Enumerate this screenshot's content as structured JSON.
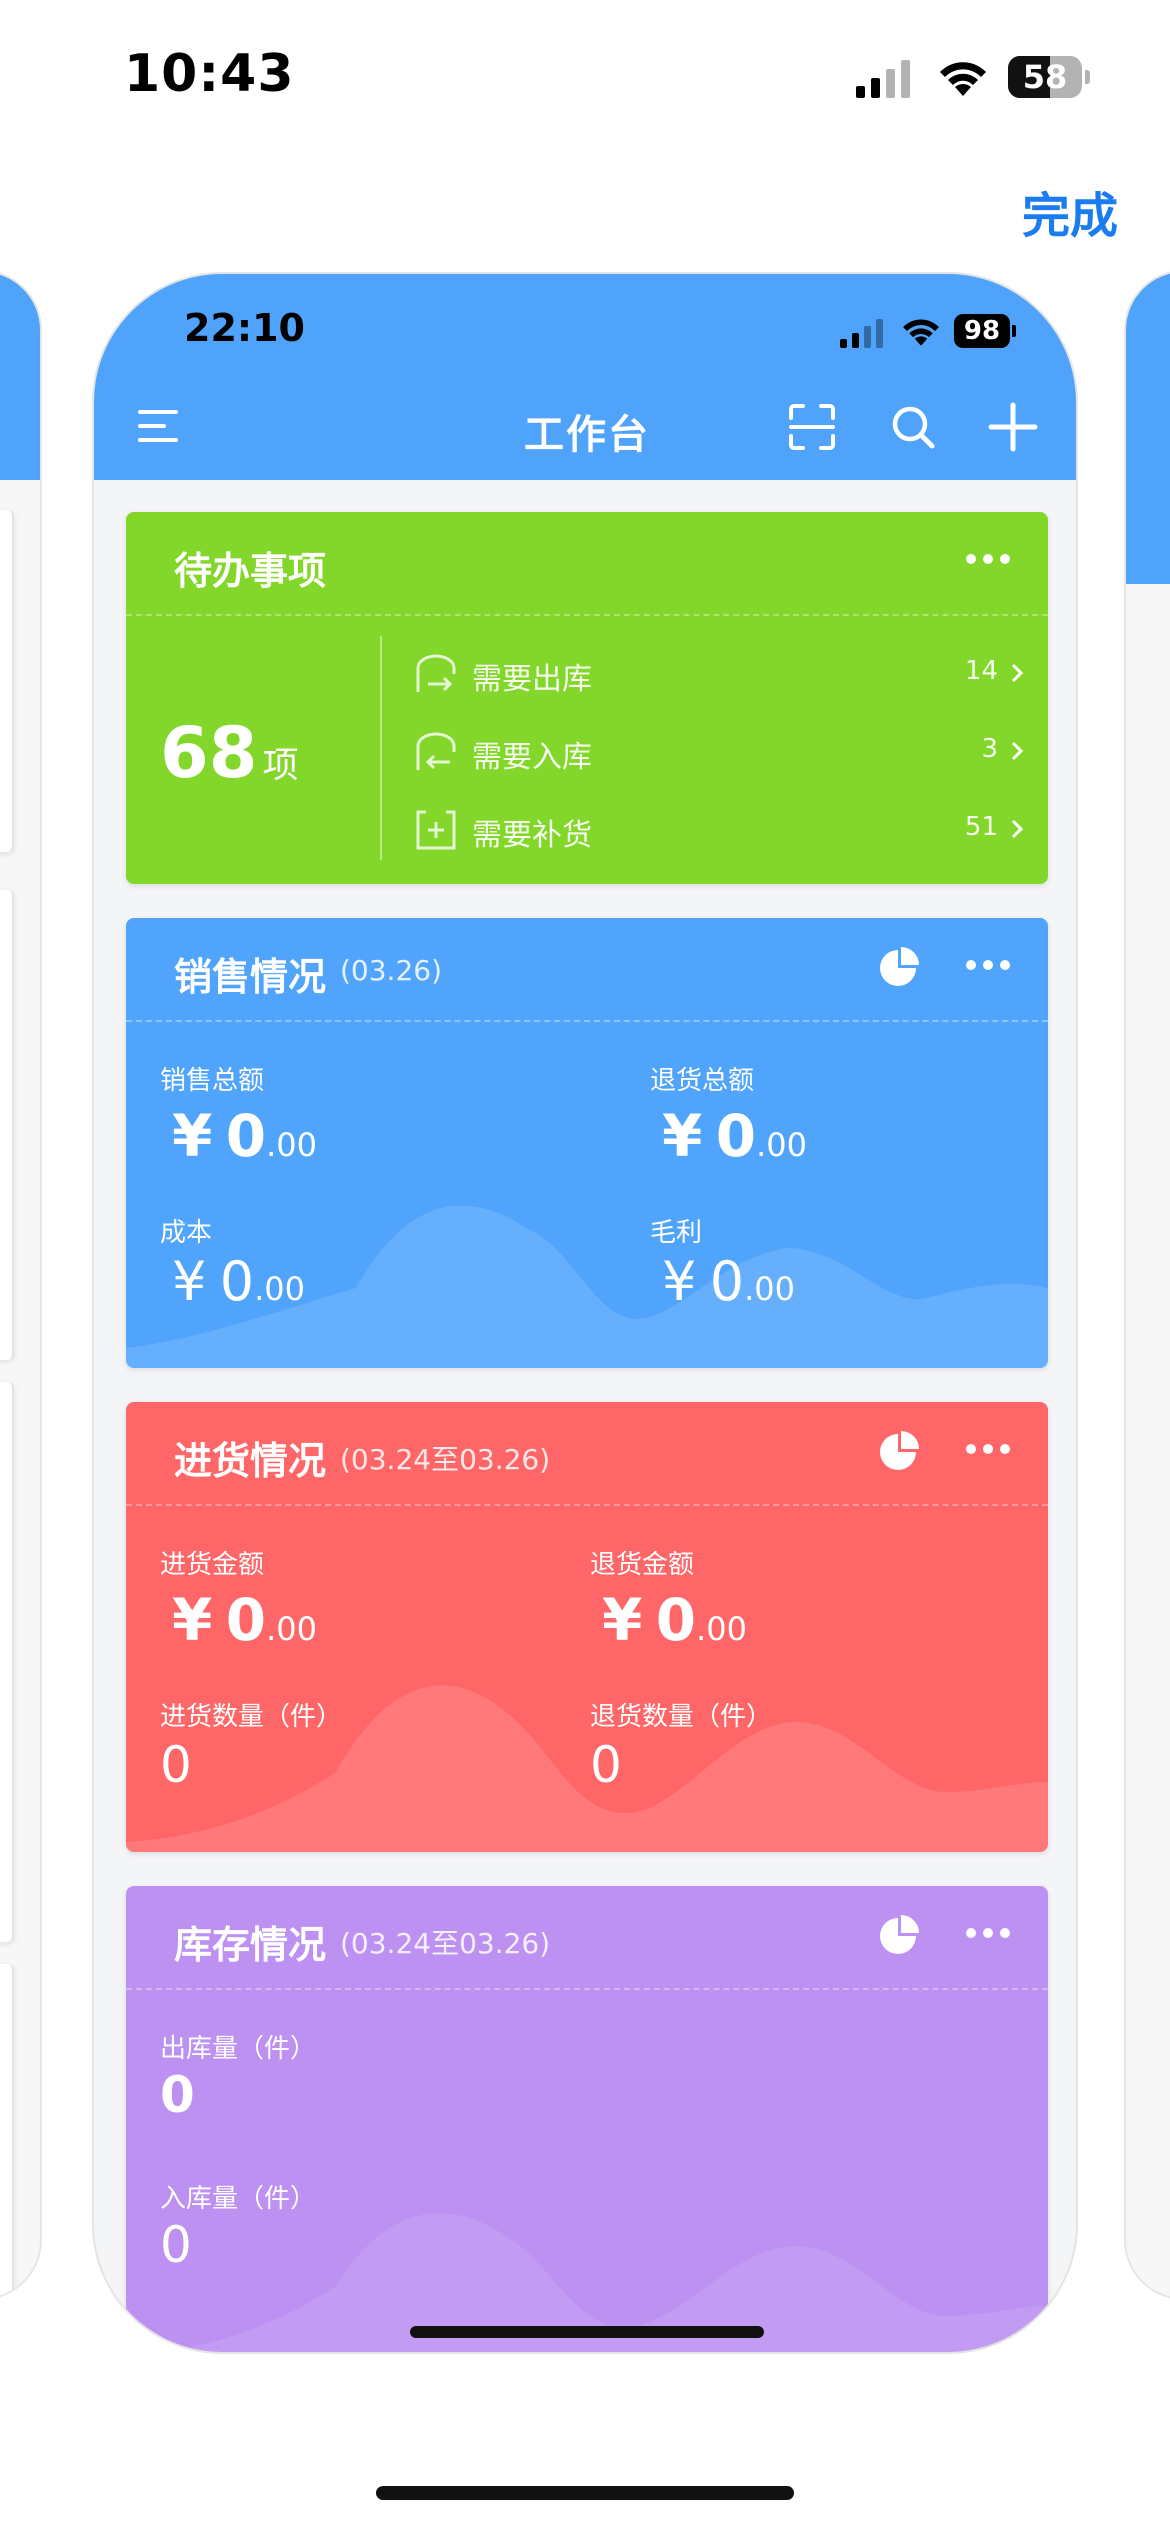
{
  "status_bar": {
    "time": "10:43",
    "battery": "58"
  },
  "top_action": {
    "done_label": "完成"
  },
  "preview": {
    "status_bar": {
      "time": "22:10",
      "battery": "98"
    },
    "header": {
      "title": "工作台",
      "icons": [
        "menu-icon",
        "scan-icon",
        "search-icon",
        "plus-icon"
      ]
    },
    "colors": {
      "header": "#4fa3fb",
      "todo": "#83d62a",
      "sales": "#50a4fc",
      "purchase": "#ff6668",
      "stock": "#bc91f1"
    },
    "todo": {
      "title": "待办事项",
      "count": "68",
      "count_unit": "项",
      "items": [
        {
          "icon": "outbound-icon",
          "label": "需要出库",
          "count": "14"
        },
        {
          "icon": "inbound-icon",
          "label": "需要入库",
          "count": "3"
        },
        {
          "icon": "restock-icon",
          "label": "需要补货",
          "count": "51"
        }
      ]
    },
    "sales": {
      "title": "销售情况",
      "date": "(03.26)",
      "total_label": "销售总额",
      "total_yen": "¥",
      "total_int": "0",
      "total_cents": ".00",
      "return_label": "退货总额",
      "return_yen": "¥",
      "return_int": "0",
      "return_cents": ".00",
      "cost_label": "成本",
      "cost_yen": "¥",
      "cost_int": "0",
      "cost_cents": ".00",
      "profit_label": "毛利",
      "profit_yen": "¥",
      "profit_int": "0",
      "profit_cents": ".00"
    },
    "purchase": {
      "title": "进货情况",
      "date": "(03.24至03.26)",
      "amount_label": "进货金额",
      "amount_yen": "¥",
      "amount_int": "0",
      "amount_cents": ".00",
      "return_label": "退货金额",
      "return_yen": "¥",
      "return_int": "0",
      "return_cents": ".00",
      "qty_label": "进货数量（件）",
      "qty_value": "0",
      "return_qty_label": "退货数量（件）",
      "return_qty_value": "0"
    },
    "stock": {
      "title": "库存情况",
      "date": "(03.24至03.26)",
      "out_label": "出库量（件）",
      "out_value": "0",
      "in_label": "入库量（件）",
      "in_value": "0"
    }
  }
}
